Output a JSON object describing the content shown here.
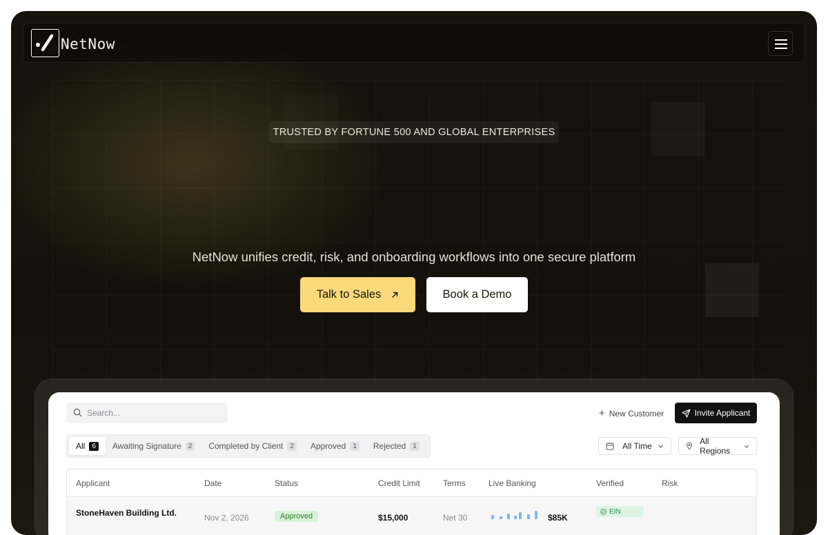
{
  "brand": {
    "name": "NetNow"
  },
  "hero": {
    "badge": "TRUSTED BY FORTUNE 500 AND GLOBAL ENTERPRISES",
    "tagline": "NetNow unifies credit, risk, and onboarding workflows into one secure platform",
    "primary_cta": "Talk to Sales",
    "secondary_cta": "Book a Demo"
  },
  "dashboard": {
    "search_placeholder": "Search...",
    "new_customer": "New Customer",
    "invite_applicant": "Invite Applicant",
    "tabs": [
      {
        "label": "All",
        "count": "6"
      },
      {
        "label": "Awaiting Signature",
        "count": "2"
      },
      {
        "label": "Completed by Client",
        "count": "2"
      },
      {
        "label": "Approved",
        "count": "1"
      },
      {
        "label": "Rejected",
        "count": "1"
      }
    ],
    "filters": {
      "time": "All Time",
      "region": "All Regions"
    },
    "columns": [
      "Applicant",
      "Date",
      "Status",
      "Credit Limit",
      "Terms",
      "Live Banking",
      "Verified",
      "Risk"
    ],
    "rows": [
      {
        "applicant": "StoneHaven Building Ltd.",
        "date": "Nov 2, 2026",
        "status": "Approved",
        "credit_limit": "$15,000",
        "terms": "Net 30",
        "live_banking_value": "$85K",
        "verified": "EIN"
      }
    ]
  },
  "colors": {
    "accent": "#f9d97a",
    "dark": "#14110a"
  }
}
